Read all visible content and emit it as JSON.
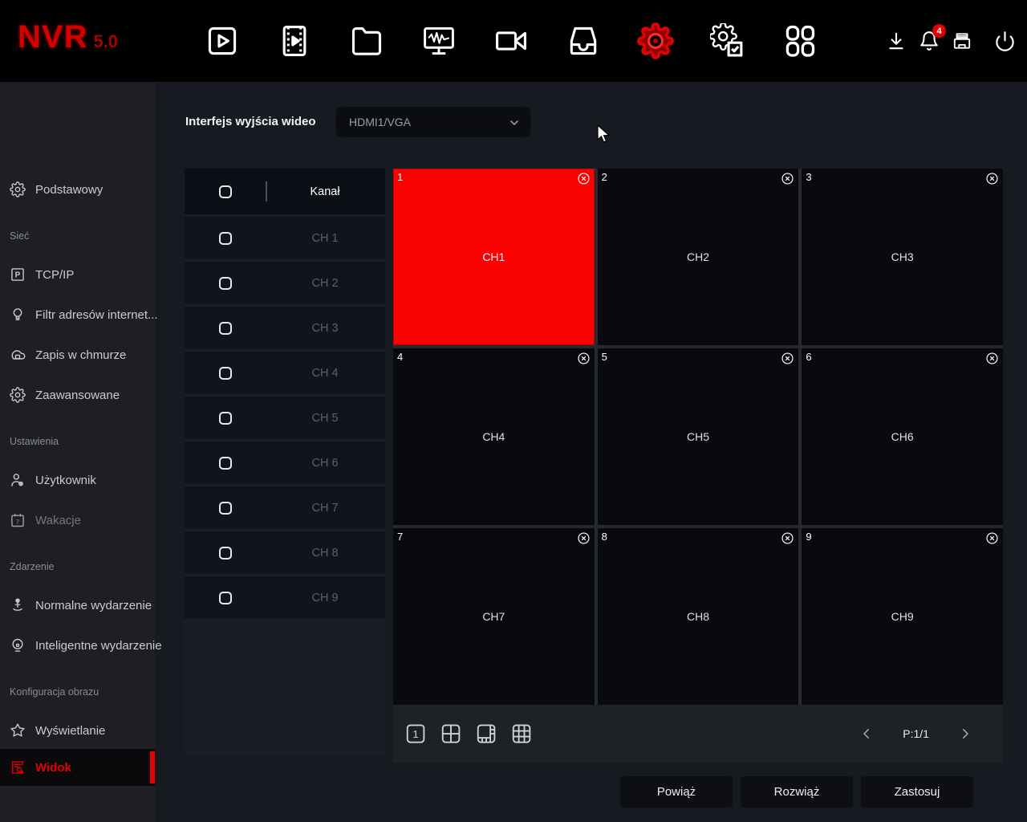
{
  "topbar": {
    "brand": "NVR",
    "version": "5.0",
    "notification_count": "4",
    "nav_icons": [
      "preview",
      "playback",
      "file-management",
      "system-maintenance",
      "camera",
      "storage",
      "settings",
      "system-service",
      "modules"
    ],
    "action_icons": [
      "download",
      "alarm-bell",
      "backup-device",
      "power"
    ]
  },
  "sidebar": {
    "items": [
      {
        "label": "Podstawowy",
        "icon": "gear"
      },
      {
        "label": "Sieć",
        "type": "section"
      },
      {
        "label": "TCP/IP",
        "icon": "tcpip-badge"
      },
      {
        "label": "Filtr adresów internet...",
        "icon": "bulb"
      },
      {
        "label": "Zapis w chmurze",
        "icon": "cloud"
      },
      {
        "label": "Zaawansowane",
        "icon": "gear"
      },
      {
        "label": "Ustawienia",
        "type": "section"
      },
      {
        "label": "Użytkownik",
        "icon": "user-gear"
      },
      {
        "label": "Wakacje",
        "icon": "calendar",
        "disabled": true
      },
      {
        "label": "Zdarzenie",
        "type": "section"
      },
      {
        "label": "Normalne wydarzenie",
        "icon": "person-event"
      },
      {
        "label": "Inteligentne wydarzenie",
        "icon": "smart-event"
      },
      {
        "label": "Konfiguracja obrazu",
        "type": "section"
      },
      {
        "label": "Wyświetlanie",
        "icon": "star"
      },
      {
        "label": "Widok",
        "icon": "doc-search",
        "active": true
      }
    ]
  },
  "main": {
    "output_interface": {
      "label": "Interfejs wyjścia wideo",
      "value": "HDMI1/VGA"
    },
    "channel_table": {
      "header": "Kanał",
      "rows": [
        "CH 1",
        "CH 2",
        "CH 3",
        "CH 4",
        "CH 5",
        "CH 6",
        "CH 7",
        "CH 8",
        "CH 9"
      ]
    },
    "grid": {
      "active_tile": "1",
      "tiles": [
        {
          "num": "1",
          "label": "CH1"
        },
        {
          "num": "2",
          "label": "CH2"
        },
        {
          "num": "3",
          "label": "CH3"
        },
        {
          "num": "4",
          "label": "CH4"
        },
        {
          "num": "5",
          "label": "CH5"
        },
        {
          "num": "6",
          "label": "CH6"
        },
        {
          "num": "7",
          "label": "CH7"
        },
        {
          "num": "8",
          "label": "CH8"
        },
        {
          "num": "9",
          "label": "CH9"
        }
      ],
      "layout_options": [
        "layout-single",
        "layout-4",
        "layout-8",
        "layout-9"
      ],
      "pagination": "P:1/1"
    },
    "buttons": {
      "bind": "Powiąż",
      "unbind": "Rozwiąż",
      "apply": "Zastosuj"
    }
  },
  "colors": {
    "accent": "#e60000",
    "tile_active": "#fb0202",
    "topbar_bg": "#000000"
  }
}
